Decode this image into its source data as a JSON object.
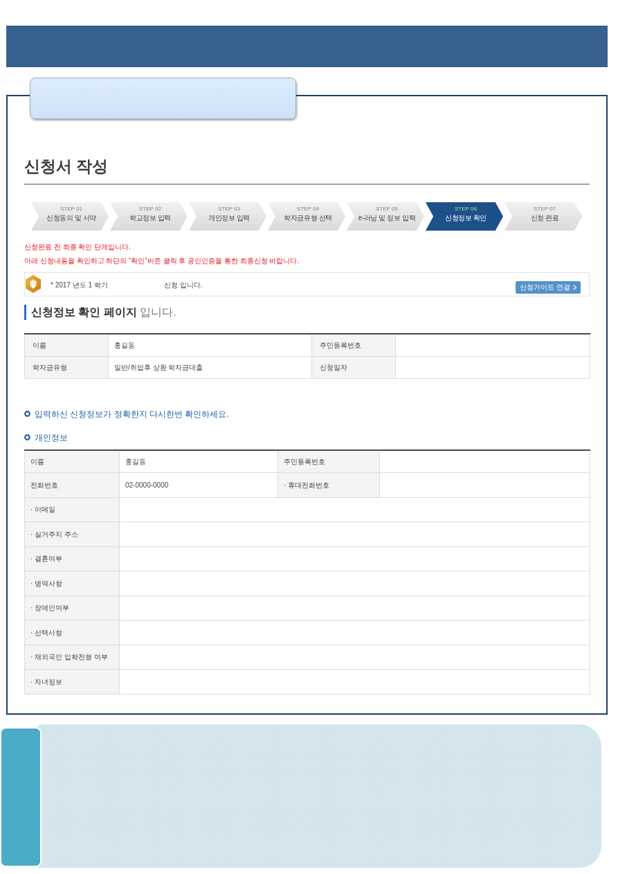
{
  "page_title": "신청서 작성",
  "steps": [
    {
      "number": "STEP 01",
      "label": "신청동의 및 서약",
      "selected": false
    },
    {
      "number": "STEP 02",
      "label": "학교정보 입력",
      "selected": false
    },
    {
      "number": "STEP 03",
      "label": "개인정보 입력",
      "selected": false
    },
    {
      "number": "STEP 04",
      "label": "학자금유형 선택",
      "selected": false
    },
    {
      "number": "STEP 05",
      "label": "e-러닝 및 정보 입력",
      "selected": false
    },
    {
      "number": "STEP 06",
      "label": "신청정보 확인",
      "selected": true
    },
    {
      "number": "STEP 07",
      "label": "신청 완료",
      "selected": false
    }
  ],
  "notices": [
    "신청완료 전 최종 확인 단계입니다.",
    "아래 신청내용을 확인하고 하단의 “확인”버튼 클릭 후 공인인증을 통한 최종신청 바랍니다."
  ],
  "term_box": {
    "term": "* 2017 년도 1 학기",
    "status": "신청 입니다.",
    "guide_button": "신청가이드 연결"
  },
  "page_heading": "**신청정보 확인 페이지** 입니다.",
  "summary_table": {
    "rows": [
      [
        {
          "label": "이름",
          "value": "홍길동"
        },
        {
          "label": "주민등록번호"
        }
      ],
      [
        {
          "label": "학자금유형",
          "value": "일반/취업후 상환 학자금대출"
        },
        {
          "label": "신청일자"
        }
      ]
    ]
  },
  "check_notice": "입력하신 신청정보가 정확한지 다시한번 확인하세요.",
  "section_title": "개인정보",
  "personal_table": {
    "rows": [
      [
        {
          "label": "이름",
          "value": "홍길동"
        },
        {
          "label": "주민등록번호"
        }
      ],
      [
        {
          "label": "전화번호",
          "value": "02-0000-0000"
        },
        {
          "label": "· 휴대전화번호"
        }
      ],
      [
        {
          "label": "· 이메일"
        }
      ],
      [
        {
          "label": "· 실거주지 주소"
        }
      ],
      [
        {
          "label": "· 결혼여부"
        }
      ],
      [
        {
          "label": "· 병역사항"
        }
      ],
      [
        {
          "label": "· 장애인여부"
        }
      ],
      [
        {
          "label": "· 선택사항"
        }
      ],
      [
        {
          "label": "· 재외국인 입학전형 여부"
        }
      ],
      [
        {
          "label": "· 자녀정보"
        }
      ]
    ]
  }
}
